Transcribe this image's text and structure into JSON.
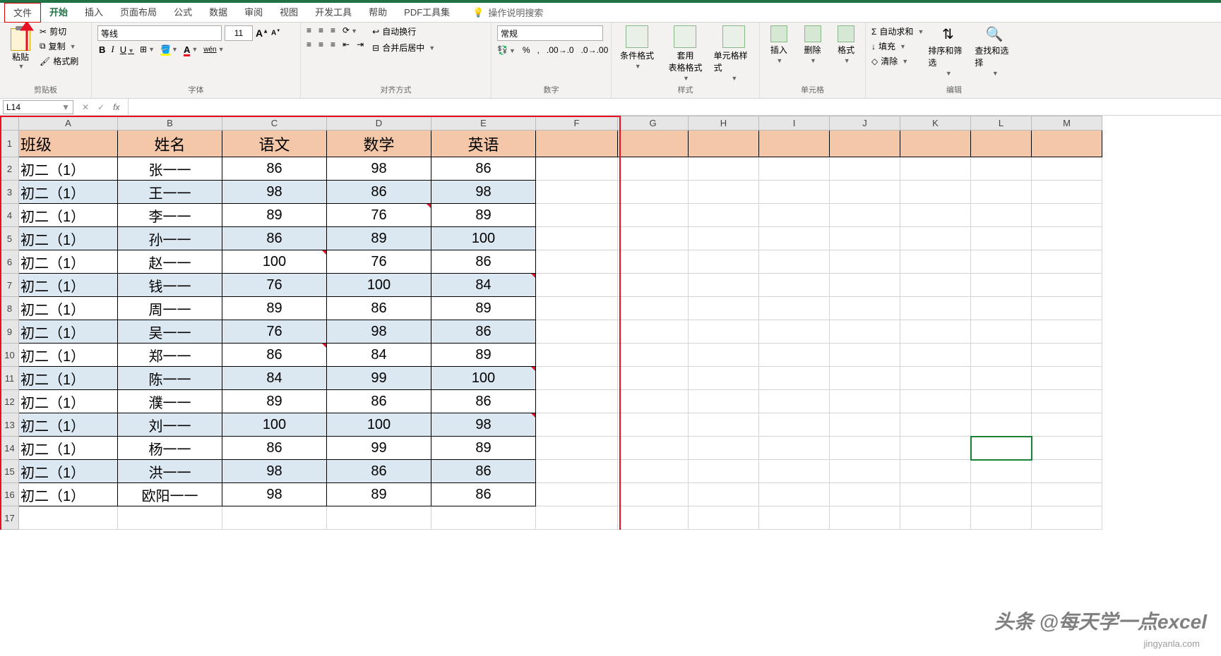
{
  "tabs": {
    "file": "文件",
    "home": "开始",
    "insert": "插入",
    "pageLayout": "页面布局",
    "formulas": "公式",
    "data": "数据",
    "review": "审阅",
    "view": "视图",
    "developer": "开发工具",
    "help": "帮助",
    "pdf": "PDF工具集"
  },
  "tellMe": "操作说明搜索",
  "clipboard": {
    "paste": "粘贴",
    "cut": "剪切",
    "copy": "复制",
    "formatPainter": "格式刷",
    "groupLabel": "剪贴板"
  },
  "font": {
    "name": "等线",
    "size": "11",
    "groupLabel": "字体",
    "ruby": "wén"
  },
  "alignment": {
    "wrapText": "自动换行",
    "mergeCenter": "合并后居中",
    "groupLabel": "对齐方式"
  },
  "number": {
    "format": "常规",
    "groupLabel": "数字"
  },
  "styles": {
    "conditional": "条件格式",
    "table": "套用\n表格格式",
    "cell": "单元格样式",
    "groupLabel": "样式"
  },
  "cells": {
    "insert": "插入",
    "delete": "删除",
    "format": "格式",
    "groupLabel": "单元格"
  },
  "editing": {
    "autosum": "自动求和",
    "fill": "填充",
    "clear": "清除",
    "sort": "排序和筛选",
    "find": "查找和选择",
    "groupLabel": "编辑"
  },
  "nameBox": "L14",
  "columns": [
    "A",
    "B",
    "C",
    "D",
    "E",
    "F",
    "G",
    "H",
    "I",
    "J",
    "K",
    "L",
    "M"
  ],
  "dataHeaders": [
    "班级",
    "姓名",
    "语文",
    "数学",
    "英语"
  ],
  "dataRows": [
    [
      "初二（1）",
      "张一一",
      "86",
      "98",
      "86"
    ],
    [
      "初二（1）",
      "王一一",
      "98",
      "86",
      "98"
    ],
    [
      "初二（1）",
      "李一一",
      "89",
      "76",
      "89"
    ],
    [
      "初二（1）",
      "孙一一",
      "86",
      "89",
      "100"
    ],
    [
      "初二（1）",
      "赵一一",
      "100",
      "76",
      "86"
    ],
    [
      "初二（1）",
      "钱一一",
      "76",
      "100",
      "84"
    ],
    [
      "初二（1）",
      "周一一",
      "89",
      "86",
      "89"
    ],
    [
      "初二（1）",
      "吴一一",
      "76",
      "98",
      "86"
    ],
    [
      "初二（1）",
      "郑一一",
      "86",
      "84",
      "89"
    ],
    [
      "初二（1）",
      "陈一一",
      "84",
      "99",
      "100"
    ],
    [
      "初二（1）",
      "濮一一",
      "89",
      "86",
      "86"
    ],
    [
      "初二（1）",
      "刘一一",
      "100",
      "100",
      "98"
    ],
    [
      "初二（1）",
      "杨一一",
      "86",
      "99",
      "89"
    ],
    [
      "初二（1）",
      "洪一一",
      "98",
      "86",
      "86"
    ],
    [
      "初二（1）",
      "欧阳一一",
      "98",
      "89",
      "86"
    ]
  ],
  "commentCells": [
    {
      "row": 4,
      "col": 4
    },
    {
      "row": 6,
      "col": 3
    },
    {
      "row": 7,
      "col": 5
    },
    {
      "row": 10,
      "col": 3
    },
    {
      "row": 11,
      "col": 5
    },
    {
      "row": 13,
      "col": 5
    }
  ],
  "watermark": "头条 @每天学一点excel",
  "watermark2": "jingyanla.com"
}
